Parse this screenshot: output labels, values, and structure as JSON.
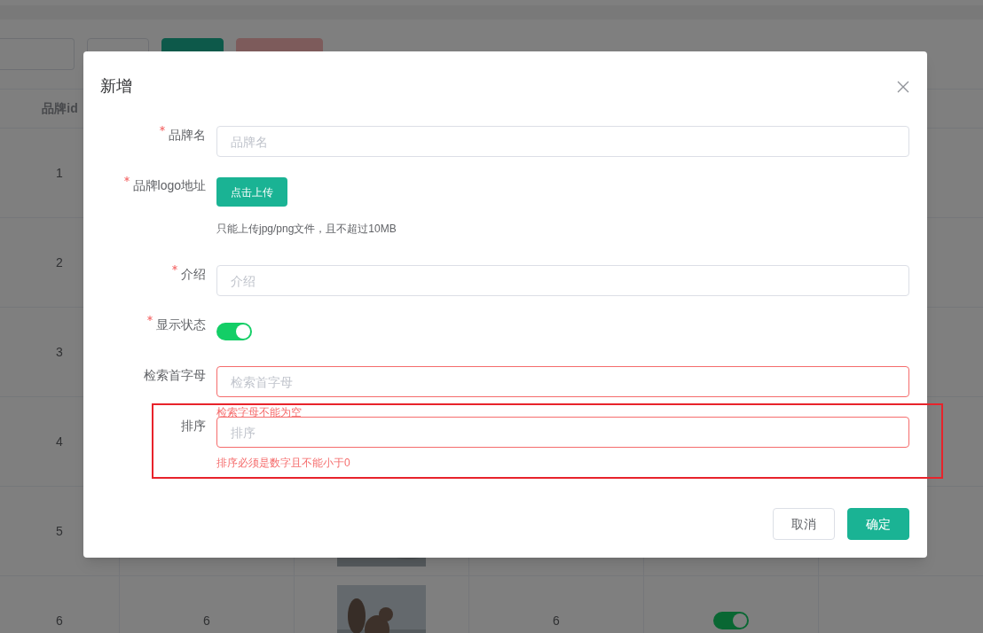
{
  "toolbar": {
    "buttons": [
      {
        "kind": "default"
      },
      {
        "kind": "primary"
      },
      {
        "kind": "danger"
      }
    ]
  },
  "table": {
    "columns": [
      "品牌id"
    ],
    "rows": [
      {
        "cells": [
          {
            "kind": "text",
            "text": "1"
          }
        ]
      },
      {
        "cells": [
          {
            "kind": "text",
            "text": "2"
          }
        ]
      },
      {
        "cells": [
          {
            "kind": "text",
            "text": "3"
          }
        ]
      },
      {
        "cells": [
          {
            "kind": "text",
            "text": "4"
          }
        ]
      },
      {
        "cells": [
          {
            "kind": "text",
            "text": "5"
          },
          null,
          {
            "kind": "picture"
          }
        ]
      },
      {
        "cells": [
          {
            "kind": "text",
            "text": "6"
          },
          {
            "kind": "text",
            "text": "6"
          },
          {
            "kind": "picture"
          },
          {
            "kind": "text",
            "text": "6"
          },
          {
            "kind": "switch",
            "on": true
          }
        ]
      }
    ]
  },
  "dialog": {
    "title": "新增",
    "items": [
      {
        "kind": "input",
        "label": "品牌名",
        "required": true,
        "placeholder": "品牌名",
        "invalid": false
      },
      {
        "kind": "upload",
        "label": "品牌logo地址",
        "required": true,
        "button": "点击上传",
        "hint": "只能上传jpg/png文件，且不超过10MB"
      },
      {
        "kind": "input",
        "label": "介绍",
        "required": true,
        "placeholder": "介绍",
        "invalid": false
      },
      {
        "kind": "switch",
        "label": "显示状态",
        "required": true,
        "on": true
      },
      {
        "kind": "input",
        "label": "检索首字母",
        "required": false,
        "placeholder": "检索首字母",
        "invalid": true,
        "error": "检索字母不能为空"
      },
      {
        "kind": "input",
        "label": "排序",
        "required": false,
        "placeholder": "排序",
        "invalid": true,
        "error": "排序必须是数字且不能小于0"
      }
    ],
    "buttons": [
      {
        "label": "取消",
        "kind": "default"
      },
      {
        "label": "确定",
        "kind": "primary"
      }
    ]
  }
}
